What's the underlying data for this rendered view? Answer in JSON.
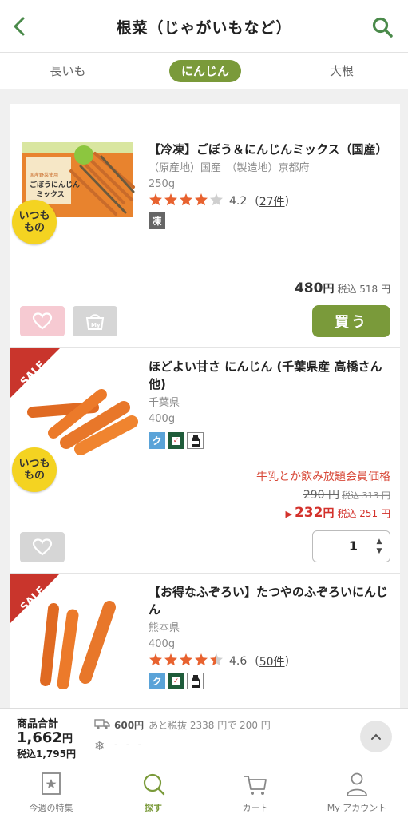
{
  "header": {
    "title": "根菜（じゃがいもなど）"
  },
  "tabs": [
    {
      "label": "長いも",
      "active": false
    },
    {
      "label": "にんじん",
      "active": true
    },
    {
      "label": "大根",
      "active": false
    }
  ],
  "products": [
    {
      "name": "【冷凍】ごぼう＆にんじんミックス（国産）",
      "origin": "（原産地）国産　（製造地）京都府",
      "weight": "250g",
      "rating": "4.2",
      "stars": 4.2,
      "reviews": "27件",
      "badge": "いつも\nもの",
      "frozen_label": "凍",
      "price": "480",
      "yen": "円",
      "tax_price": "税込 518 円",
      "favorite_active": true,
      "buy_label": "買う",
      "package_text": "ごぼうにんじん\nミックス",
      "package_tag": "国産野菜使用"
    },
    {
      "name": "ほどよい甘さ にんじん (千葉県産 高橋さん他)",
      "origin": "千葉県",
      "weight": "400g",
      "sale_label": "SALE",
      "badge": "いつも\nもの",
      "promo": "牛乳とか飲み放題会員価格",
      "old_price": "290 円",
      "old_tax": "税込 313 円",
      "price": "232",
      "yen": "円",
      "tax_price": "税込 251 円",
      "quantity": "1"
    },
    {
      "name": "【お得なふぞろい】たつやのふぞろいにんじん",
      "origin": "熊本県",
      "weight": "400g",
      "sale_label": "SALE",
      "rating": "4.6",
      "stars": 4.6,
      "reviews": "50件"
    }
  ],
  "summary": {
    "label": "商品合計",
    "total": "1,662",
    "total_yen": "円",
    "tax_total": "税込1,795円",
    "shipping_fee": "600円",
    "shipping_note": "あと税抜 2338 円で 200 円",
    "frozen_status": "- - -"
  },
  "nav": [
    {
      "label": "今週の特集",
      "icon": "star-calendar-icon"
    },
    {
      "label": "探す",
      "icon": "search-icon",
      "active": true
    },
    {
      "label": "カート",
      "icon": "cart-icon"
    },
    {
      "label": "My アカウント",
      "icon": "person-icon"
    }
  ],
  "colors": {
    "accent": "#7a9a3a",
    "sale": "#d3322c",
    "badge": "#f4d321",
    "star": "#e8622f"
  }
}
